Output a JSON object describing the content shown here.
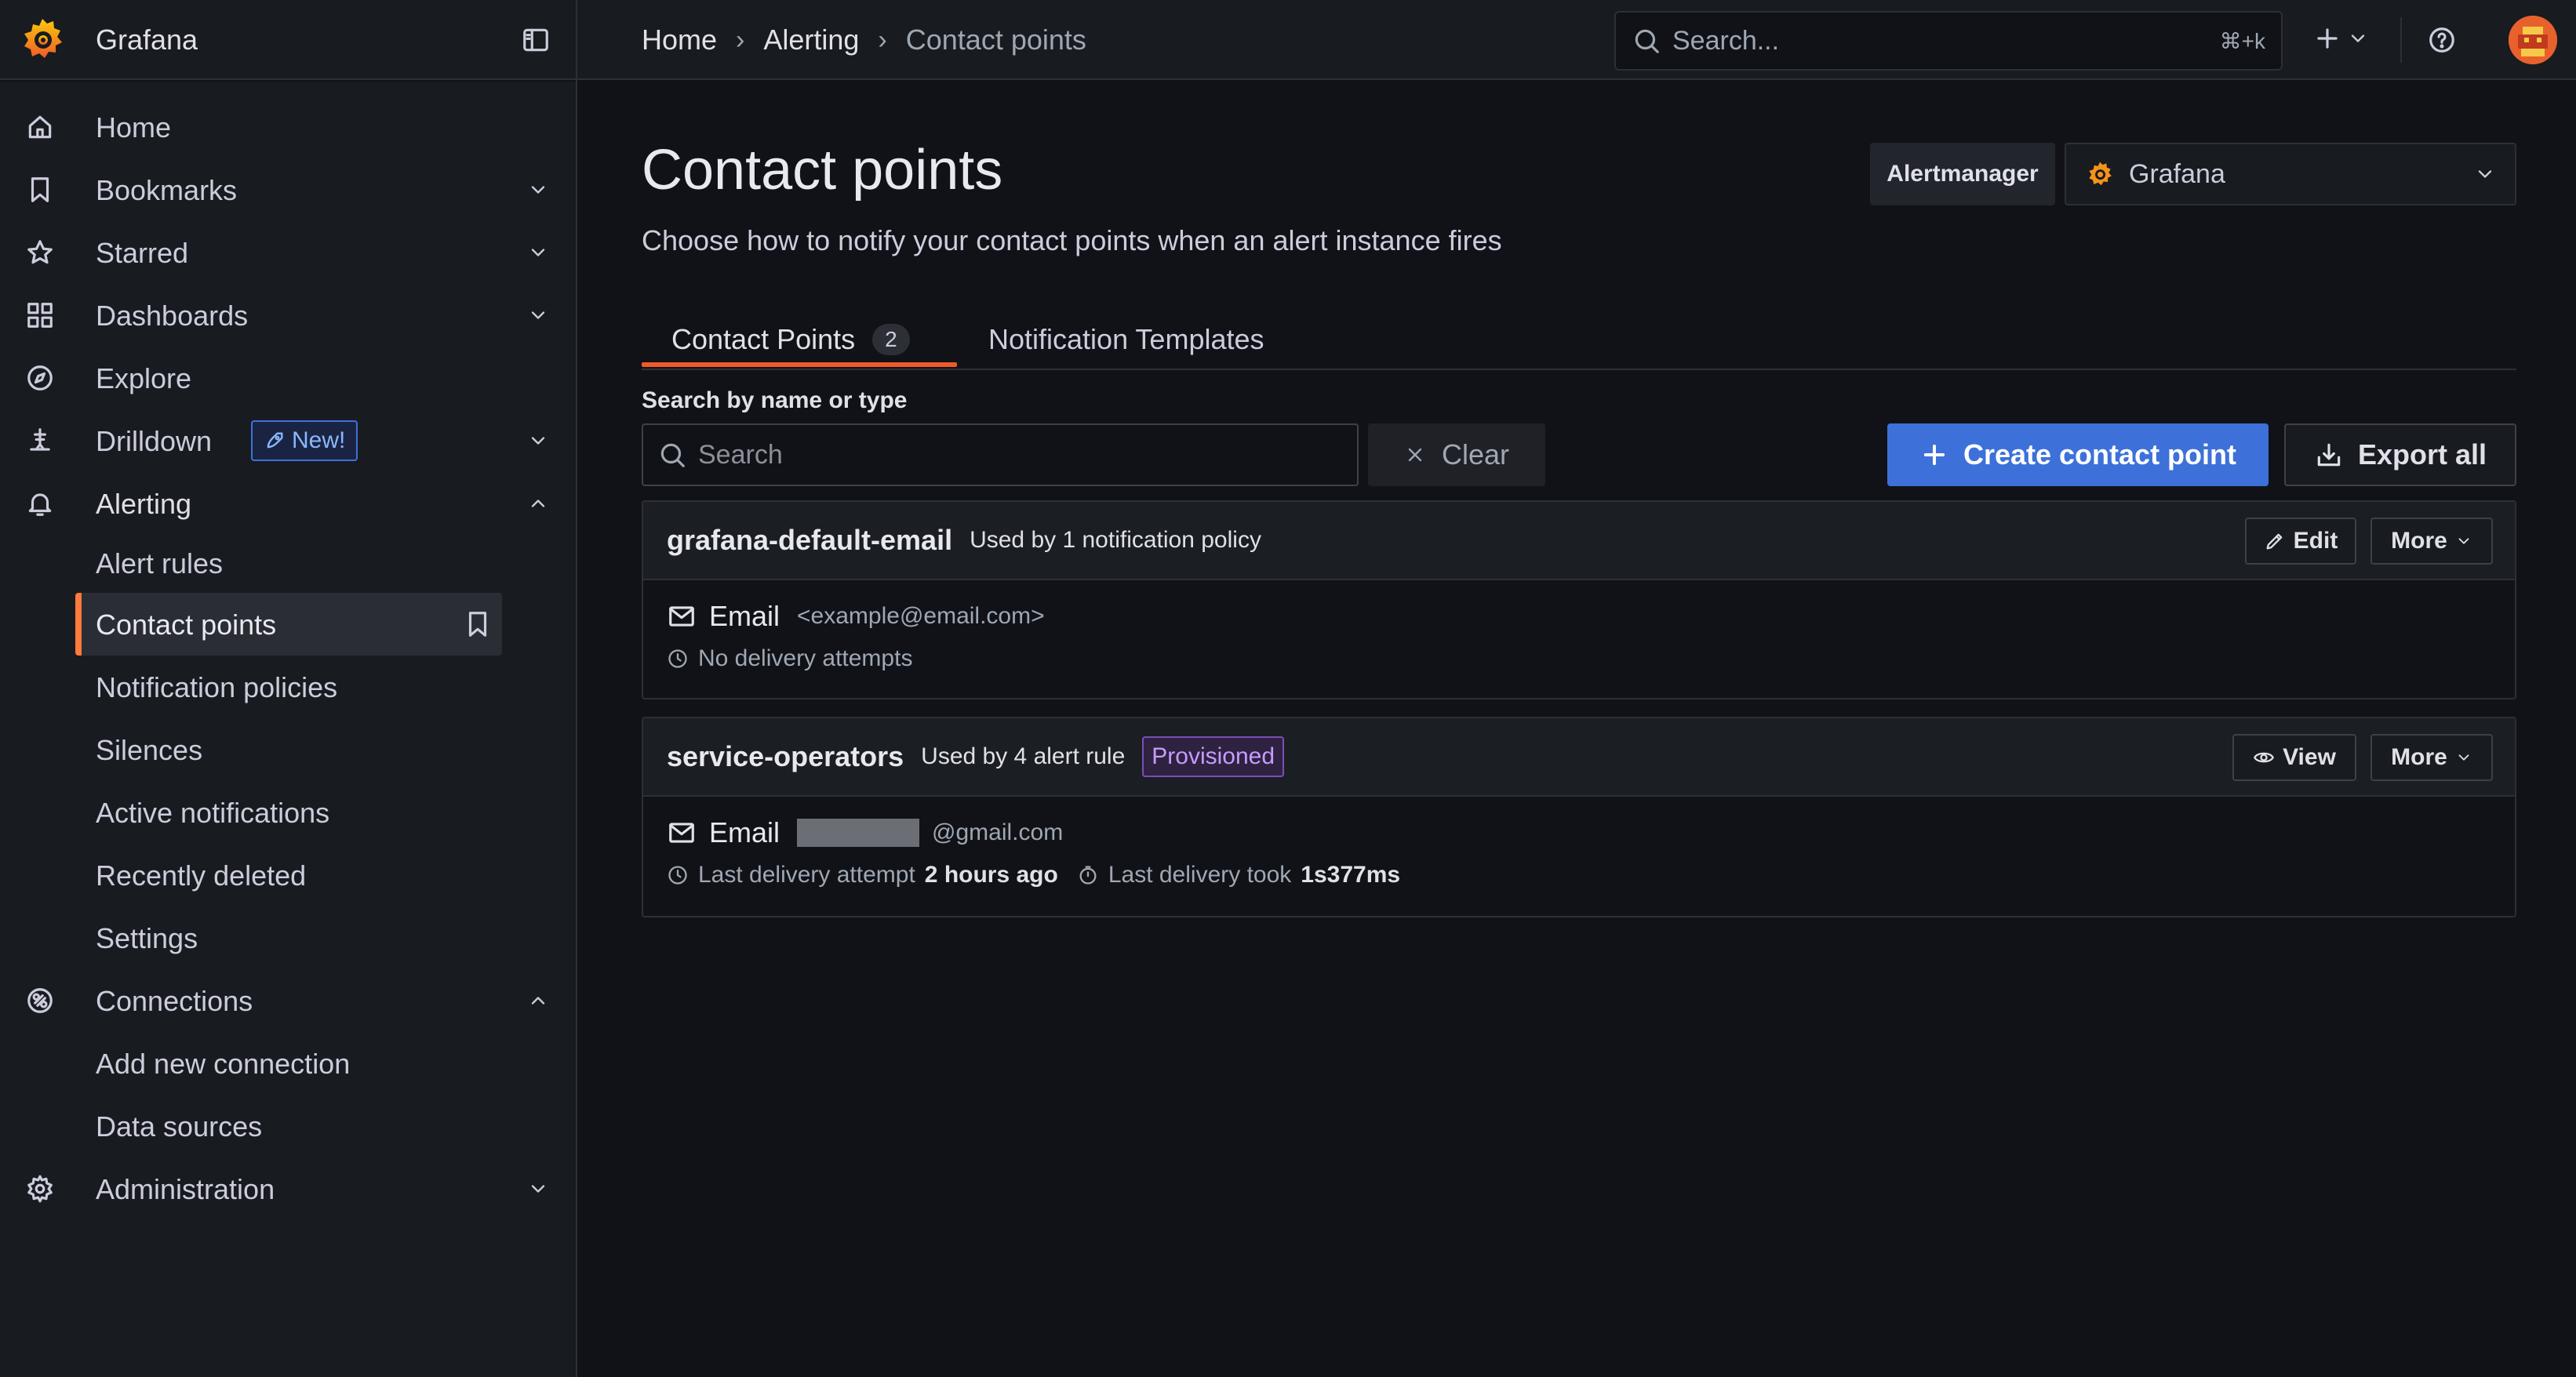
{
  "app": {
    "brand": "Grafana"
  },
  "breadcrumbs": [
    "Home",
    "Alerting",
    "Contact points"
  ],
  "topbar": {
    "search_placeholder": "Search...",
    "search_shortcut": "⌘+k"
  },
  "sidebar": {
    "items": [
      {
        "label": "Home",
        "icon": "home-icon"
      },
      {
        "label": "Bookmarks",
        "icon": "bookmark-icon"
      },
      {
        "label": "Starred",
        "icon": "star-icon"
      },
      {
        "label": "Dashboards",
        "icon": "dashboards-icon"
      },
      {
        "label": "Explore",
        "icon": "compass-icon"
      },
      {
        "label": "Drilldown",
        "icon": "drilldown-icon",
        "badge": "New!"
      },
      {
        "label": "Alerting",
        "icon": "bell-icon"
      },
      {
        "label": "Alert rules"
      },
      {
        "label": "Contact points"
      },
      {
        "label": "Notification policies"
      },
      {
        "label": "Silences"
      },
      {
        "label": "Active notifications"
      },
      {
        "label": "Recently deleted"
      },
      {
        "label": "Settings"
      },
      {
        "label": "Connections",
        "icon": "connections-icon"
      },
      {
        "label": "Add new connection"
      },
      {
        "label": "Data sources"
      },
      {
        "label": "Administration",
        "icon": "gear-icon"
      }
    ]
  },
  "page": {
    "title": "Contact points",
    "subtitle": "Choose how to notify your contact points when an alert instance fires",
    "alertmanager_label": "Alertmanager",
    "alertmanager_value": "Grafana"
  },
  "tabs": [
    {
      "label": "Contact Points",
      "count": "2"
    },
    {
      "label": "Notification Templates"
    }
  ],
  "search": {
    "label": "Search by name or type",
    "placeholder": "Search",
    "clear_label": "Clear"
  },
  "actions": {
    "create_label": "Create contact point",
    "export_label": "Export all"
  },
  "contact_points": [
    {
      "name": "grafana-default-email",
      "used_by": "Used by 1 notification policy",
      "action_label": "Edit",
      "more_label": "More",
      "integration": "Email",
      "address": "<example@email.com>",
      "status": "No delivery attempts"
    },
    {
      "name": "service-operators",
      "used_by": "Used by 4 alert rule",
      "badge": "Provisioned",
      "action_label": "View",
      "more_label": "More",
      "integration": "Email",
      "address_suffix": "@gmail.com",
      "last_attempt_label": "Last delivery attempt",
      "last_attempt_value": "2 hours ago",
      "last_duration_label": "Last delivery took",
      "last_duration_value": "1s377ms"
    }
  ],
  "colors": {
    "accent_orange": "#f05a28",
    "primary_blue": "#3d71d9",
    "provisioned_purple": "#c89bff"
  }
}
